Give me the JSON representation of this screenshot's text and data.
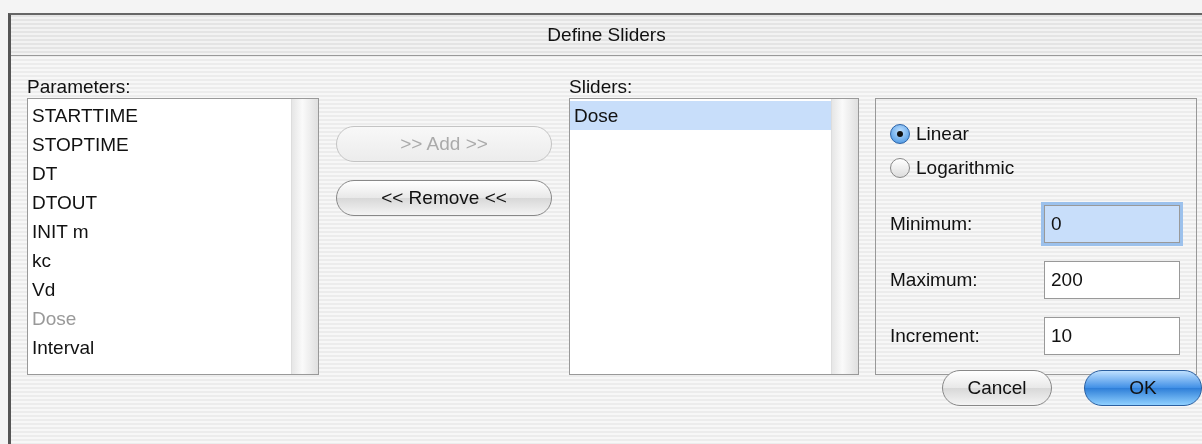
{
  "window": {
    "title": "Define Sliders"
  },
  "parameters": {
    "label": "Parameters:",
    "items": [
      {
        "name": "STARTTIME",
        "disabled": false
      },
      {
        "name": "STOPTIME",
        "disabled": false
      },
      {
        "name": "DT",
        "disabled": false
      },
      {
        "name": "DTOUT",
        "disabled": false
      },
      {
        "name": "INIT m",
        "disabled": false
      },
      {
        "name": "kc",
        "disabled": false
      },
      {
        "name": "Vd",
        "disabled": false
      },
      {
        "name": "Dose",
        "disabled": true
      },
      {
        "name": "Interval",
        "disabled": false
      }
    ]
  },
  "transfer_buttons": [
    {
      "label": ">> Add >>",
      "disabled": true
    },
    {
      "label": "<< Remove <<",
      "disabled": false
    }
  ],
  "sliders": {
    "label": "Sliders:",
    "items": [
      {
        "name": "Dose",
        "selected": true
      }
    ]
  },
  "scale": [
    {
      "label": "Linear",
      "selected": true
    },
    {
      "label": "Logarithmic",
      "selected": false
    }
  ],
  "fields": [
    {
      "label": "Minimum:",
      "value": "0",
      "focused": true
    },
    {
      "label": "Maximum:",
      "value": "200",
      "focused": false
    },
    {
      "label": "Increment:",
      "value": "10",
      "focused": false
    }
  ],
  "buttons": [
    {
      "label": "Cancel",
      "default": false
    },
    {
      "label": "OK",
      "default": true
    }
  ]
}
